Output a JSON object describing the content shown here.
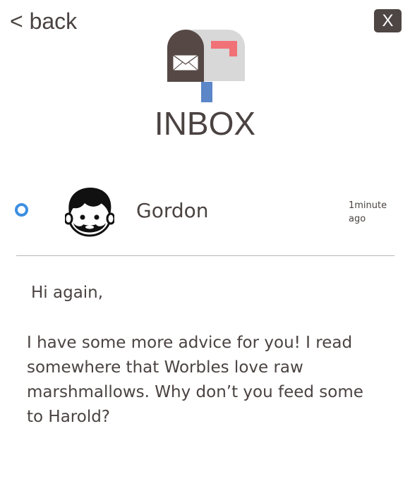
{
  "nav": {
    "back_label": "< back",
    "close_label": "X"
  },
  "header": {
    "title": "INBOX",
    "icon": "mailbox-icon"
  },
  "message": {
    "sender": "Gordon",
    "time": "1minute ago",
    "greeting": "Hi again,",
    "body": "I have some more advice for you! I read somewhere that Worbles love raw marshmallows. Why don’t you feed some to Harold?",
    "avatar": "boy-face-icon",
    "unread": true
  },
  "colors": {
    "accent": "#3d8fe0",
    "text": "#4a4341",
    "close_bg": "#4e4644",
    "flag": "#f07276",
    "post": "#5b86c8"
  }
}
